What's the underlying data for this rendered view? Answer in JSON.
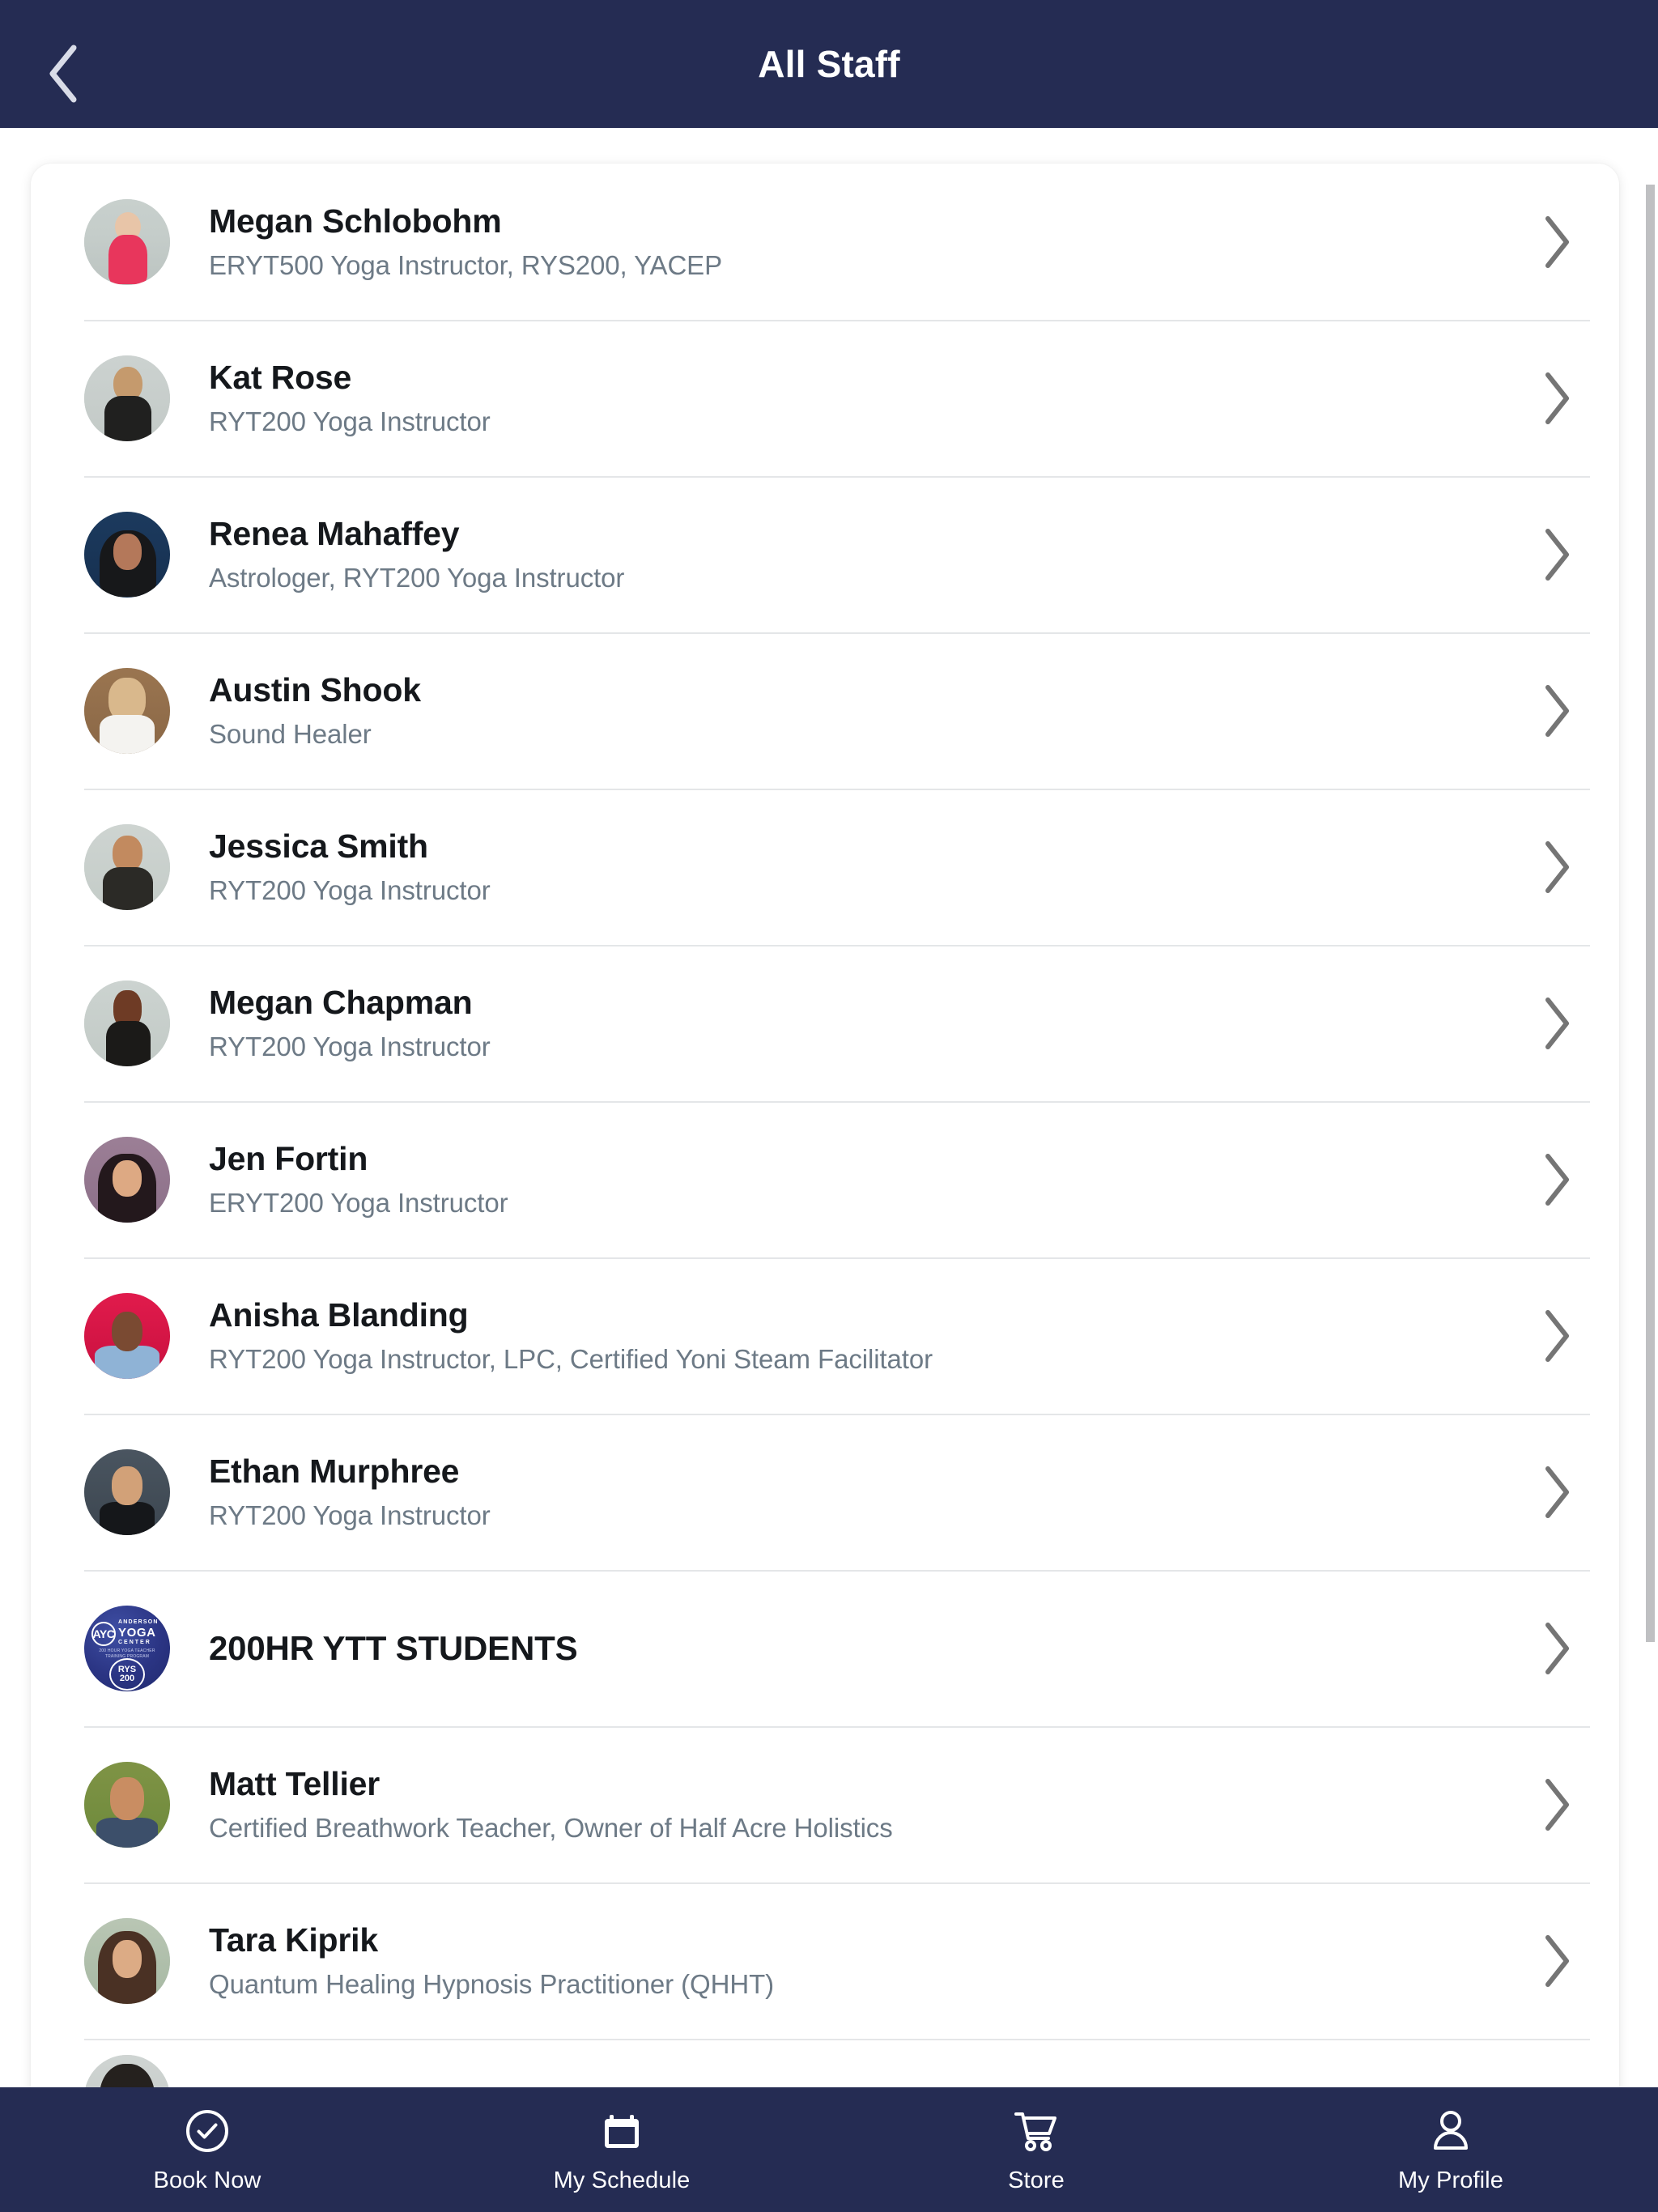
{
  "header": {
    "title": "All Staff",
    "back_icon": "chevron-left-icon",
    "background_color": "#252c53"
  },
  "scrollbar": {
    "visible": true,
    "thumb_color": "#bfc0c2"
  },
  "staff_list": {
    "chevron_icon": "chevron-right-icon",
    "items": [
      {
        "name": "Megan Schlobohm",
        "title": "ERYT500 Yoga Instructor, RYS200, YACEP",
        "avatar": "pa-megan"
      },
      {
        "name": "Kat Rose",
        "title": "RYT200 Yoga Instructor",
        "avatar": "pa-kat"
      },
      {
        "name": "Renea Mahaffey",
        "title": "Astrologer, RYT200 Yoga Instructor",
        "avatar": "pa-renea"
      },
      {
        "name": "Austin Shook",
        "title": "Sound Healer",
        "avatar": "pa-austin"
      },
      {
        "name": "Jessica Smith",
        "title": "RYT200 Yoga Instructor",
        "avatar": "pa-jessica"
      },
      {
        "name": "Megan Chapman",
        "title": "RYT200 Yoga Instructor",
        "avatar": "pa-chapman"
      },
      {
        "name": "Jen Fortin",
        "title": "ERYT200 Yoga Instructor",
        "avatar": "pa-jen"
      },
      {
        "name": "Anisha Blanding",
        "title": "RYT200 Yoga Instructor, LPC, Certified Yoni Steam Facilitator",
        "avatar": "pa-anisha"
      },
      {
        "name": "Ethan Murphree",
        "title": "RYT200 Yoga Instructor",
        "avatar": "pa-ethan"
      },
      {
        "name": "200HR YTT STUDENTS",
        "title": "",
        "avatar": "logo-ayc"
      },
      {
        "name": "Matt Tellier",
        "title": "Certified Breathwork Teacher, Owner of Half Acre Holistics",
        "avatar": "pa-matt"
      },
      {
        "name": "Tara Kiprik",
        "title": "Quantum Healing Hypnosis Practitioner (QHHT)",
        "avatar": "pa-tara"
      }
    ]
  },
  "logo": {
    "monogram": "AYC",
    "line_anderson": "ANDERSON",
    "line_yoga": "YOGA",
    "line_center": "CENTER",
    "line_sub": "200 HOUR YOGA TEACHER TRAINING PROGRAM",
    "badge_line1": "RYS",
    "badge_line2": "200"
  },
  "bottom_nav": {
    "background_color": "#252c53",
    "items": [
      {
        "label": "Book Now",
        "icon": "check-circle-icon"
      },
      {
        "label": "My Schedule",
        "icon": "calendar-icon"
      },
      {
        "label": "Store",
        "icon": "shopping-cart-icon"
      },
      {
        "label": "My Profile",
        "icon": "person-icon"
      }
    ]
  }
}
